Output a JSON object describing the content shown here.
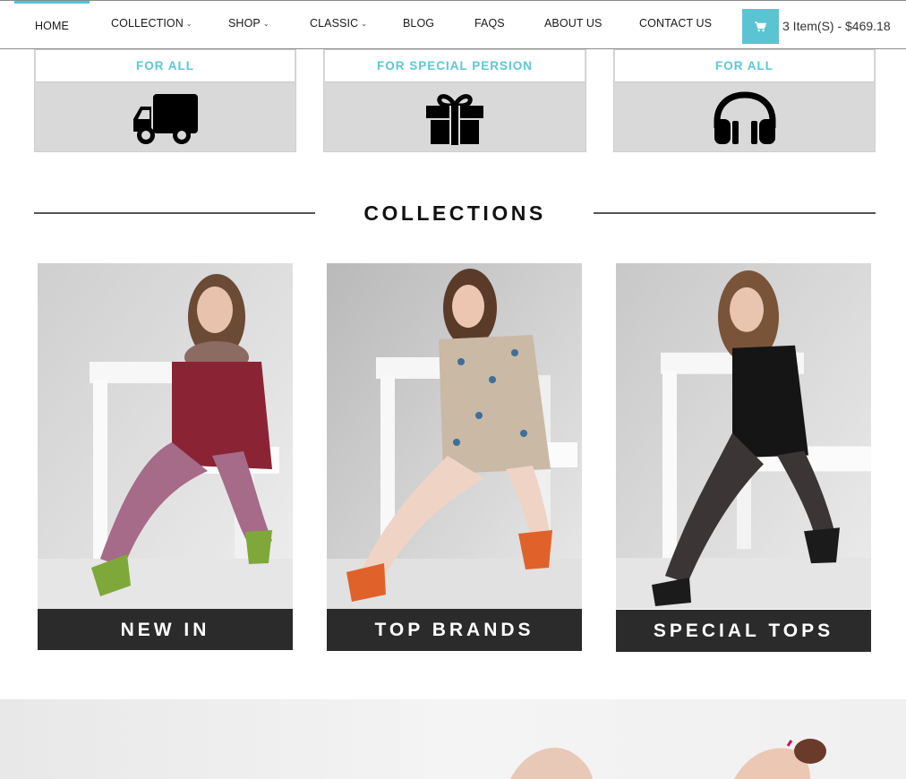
{
  "nav": {
    "items": [
      {
        "label": "HOME",
        "active": true
      },
      {
        "label": "COLLECTION",
        "has_dropdown": true
      },
      {
        "label": "SHOP",
        "has_dropdown": true
      },
      {
        "label": "CLASSIC",
        "has_dropdown": true
      },
      {
        "label": "BLOG"
      },
      {
        "label": "FAQS"
      },
      {
        "label": "ABOUT US"
      },
      {
        "label": "CONTACT US"
      }
    ],
    "cart_icon": "shopping-cart-icon",
    "cart_summary": "3 Item(S) - $469.18",
    "accent_color": "#5bc4d3"
  },
  "features": [
    {
      "label": "FOR ALL",
      "icon": "delivery-truck-icon"
    },
    {
      "label": "FOR SPECIAL PERSION",
      "icon": "gift-icon"
    },
    {
      "label": "FOR ALL",
      "icon": "headphones-icon"
    }
  ],
  "collections": {
    "title": "COLLECTIONS",
    "cards": [
      {
        "caption": "NEW IN",
        "outfit_color": "#8a2435",
        "shoe_color": "#7fa83a"
      },
      {
        "caption": "TOP BRANDS",
        "outfit_color": "#c9b9a5",
        "shoe_color": "#e0622a"
      },
      {
        "caption": "SPECIAL TOPS",
        "outfit_color": "#151515",
        "shoe_color": "#1b1b1b"
      }
    ]
  },
  "colors": {
    "label_text": "#5bc8d6",
    "feature_bg": "#d9d9d9",
    "caption_bg": "#2b2b2b"
  }
}
